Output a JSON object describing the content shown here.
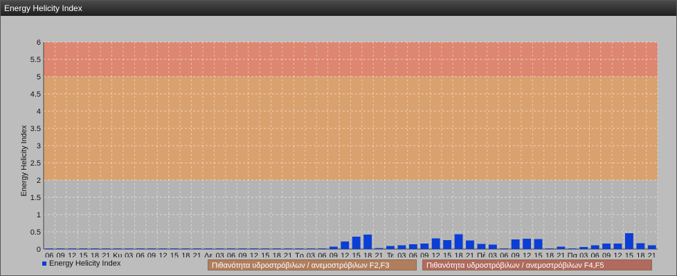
{
  "window": {
    "title": "Energy Helicity Index"
  },
  "colors": {
    "band_low": "#b4b4b4",
    "band_mid": "#d9a16e",
    "band_high": "#dd8670",
    "bar": "#0a3ed6",
    "legend_f2f3": "#b07e5e",
    "legend_f4f5": "#b06a5e"
  },
  "legend": {
    "series": "Energy Helicity Index",
    "band_f2f3": "Πιθανότητα υδροστρόβιλων / ανεμοστρόβιλων F2,F3",
    "band_f4f5": "Πιθανότητα υδροστρόβιλων / ανεμοστρόβιλων F4,F5"
  },
  "chart_data": {
    "type": "bar",
    "title": "Energy Helicity Index",
    "ylabel": "Energy Helicity Index",
    "xlabel": "",
    "ylim": [
      0,
      6
    ],
    "yticks": [
      "0",
      "0.5",
      "1",
      "1.5",
      "2",
      "2.5",
      "3",
      "3.5",
      "4",
      "4.5",
      "5",
      "5.5",
      "6"
    ],
    "bands": [
      {
        "from": 0,
        "to": 2,
        "color": "#b4b4b4"
      },
      {
        "from": 2,
        "to": 5,
        "color": "#d9a16e",
        "label": "Πιθανότητα υδροστρόβιλων / ανεμοστρόβιλων F2,F3"
      },
      {
        "from": 5,
        "to": 6,
        "color": "#dd8670",
        "label": "Πιθανότητα υδροστρόβιλων / ανεμοστρόβιλων F4,F5"
      }
    ],
    "categories": [
      "06",
      "09",
      "12",
      "15",
      "18",
      "21",
      "Κυ",
      "03",
      "06",
      "09",
      "12",
      "15",
      "18",
      "21",
      "Δε",
      "03",
      "06",
      "09",
      "12",
      "15",
      "18",
      "21",
      "Τρ",
      "03",
      "06",
      "09",
      "12",
      "15",
      "18",
      "21",
      "Τε",
      "03",
      "06",
      "09",
      "12",
      "15",
      "18",
      "21",
      "Πέ",
      "03",
      "06",
      "09",
      "12",
      "15",
      "18",
      "21",
      "Πα",
      "03",
      "06",
      "09",
      "12",
      "15",
      "18",
      "21"
    ],
    "series": [
      {
        "name": "Energy Helicity Index",
        "values": [
          0.02,
          0.02,
          0.02,
          0.02,
          0.02,
          0.02,
          0.02,
          0.02,
          0.02,
          0.02,
          0.02,
          0.02,
          0.02,
          0.02,
          0.02,
          0.02,
          0.02,
          0.02,
          0.02,
          0.02,
          0.02,
          0.02,
          0.02,
          0.02,
          0.02,
          0.07,
          0.22,
          0.36,
          0.42,
          0.03,
          0.09,
          0.11,
          0.14,
          0.16,
          0.31,
          0.26,
          0.43,
          0.25,
          0.15,
          0.13,
          0.02,
          0.28,
          0.3,
          0.29,
          0.02,
          0.07,
          0.02,
          0.06,
          0.11,
          0.16,
          0.16,
          0.46,
          0.17,
          0.11
        ]
      }
    ],
    "grid": true,
    "legend_position": "bottom-left"
  }
}
